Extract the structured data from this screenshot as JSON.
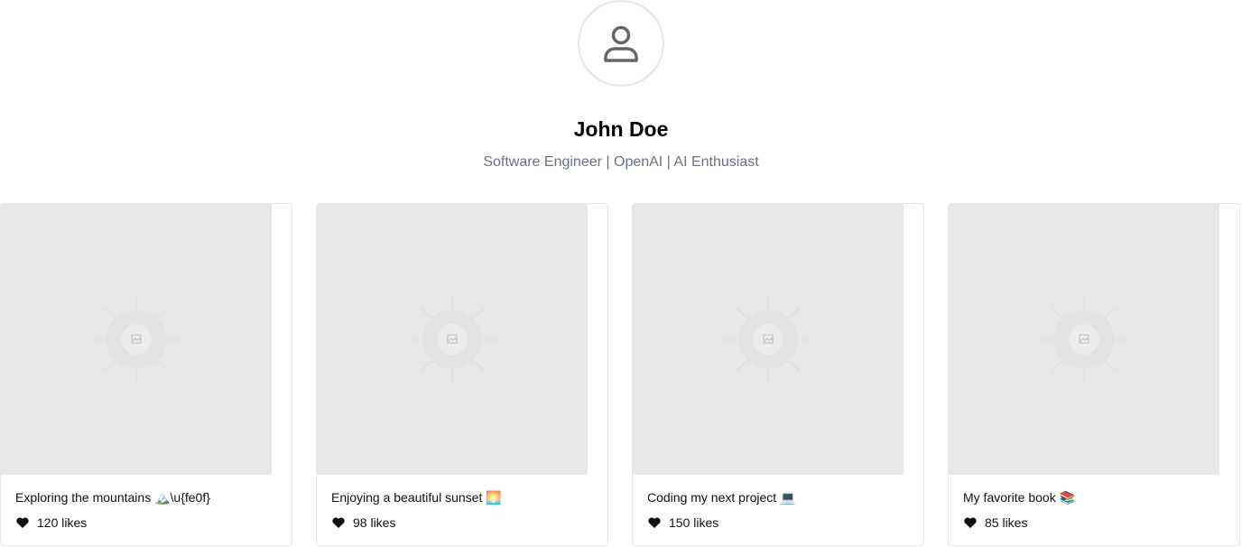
{
  "profile": {
    "avatar_icon": "user-icon",
    "name": "John Doe",
    "bio": "Software Engineer | OpenAI | AI Enthusiast"
  },
  "posts": [
    {
      "caption": "Exploring the mountains 🏔️\\u{fe0f}",
      "likes_text": "120 likes",
      "image_icon": "image-placeholder-icon"
    },
    {
      "caption": "Enjoying a beautiful sunset 🌅",
      "likes_text": "98 likes",
      "image_icon": "image-placeholder-icon"
    },
    {
      "caption": "Coding my next project 💻",
      "likes_text": "150 likes",
      "image_icon": "image-placeholder-icon"
    },
    {
      "caption": "My favorite book 📚",
      "likes_text": "85 likes",
      "image_icon": "image-placeholder-icon"
    }
  ],
  "colors": {
    "avatar_border": "#e5e7eb",
    "bio_text": "#6b7280",
    "image_placeholder": "#e8e8e8"
  }
}
